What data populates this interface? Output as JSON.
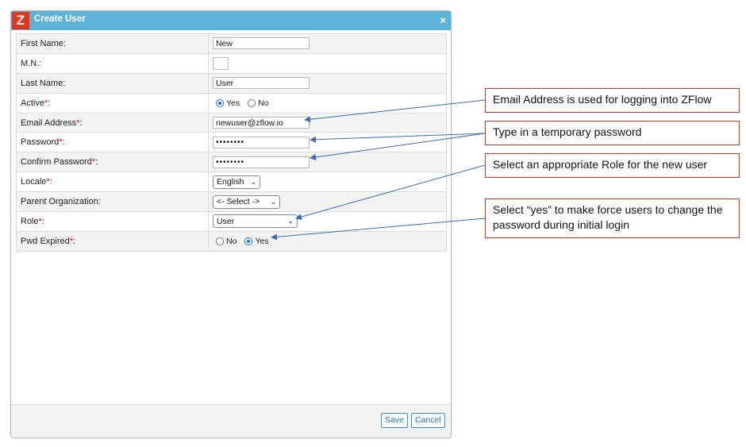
{
  "dialog": {
    "logo": "Z",
    "title": "Create User",
    "close_glyph": "×"
  },
  "fields": {
    "first_name": {
      "label": "First Name:",
      "value": "New"
    },
    "middle_name": {
      "label": "M.N.:",
      "value": ""
    },
    "last_name": {
      "label": "Last Name:",
      "value": "User"
    },
    "active": {
      "label": "Active",
      "required": "*",
      "suffix": ":",
      "options": [
        "Yes",
        "No"
      ],
      "selected": "Yes"
    },
    "email": {
      "label": "Email Address",
      "required": "*",
      "suffix": ":",
      "value": "newuser@zflow.io"
    },
    "password": {
      "label": "Password",
      "required": "*",
      "suffix": ":",
      "value": "••••••••"
    },
    "confirm_password": {
      "label": "Confirm Password",
      "required": "*",
      "suffix": ":",
      "value": "••••••••"
    },
    "locale": {
      "label": "Locale",
      "required": "*",
      "suffix": ":",
      "value": "English"
    },
    "parent_org": {
      "label": "Parent Organization:",
      "value": "<- Select ->"
    },
    "role": {
      "label": "Role",
      "required": "*",
      "suffix": ":",
      "value": "User"
    },
    "pwd_expired": {
      "label": "Pwd Expired",
      "required": "*",
      "suffix": ":",
      "options": [
        "No",
        "Yes"
      ],
      "selected": "Yes"
    }
  },
  "footer": {
    "save_label": "Save",
    "cancel_label": "Cancel"
  },
  "callouts": {
    "email": "Email Address is used for logging into ZFlow",
    "password": "Type in a temporary password",
    "role": "Select an appropriate Role for the new user",
    "pwd_expired": "Select “yes” to make force users to change the password during initial login"
  },
  "colors": {
    "titlebar": "#5fb3d9",
    "logo": "#e2371d",
    "callout_border": "#c0392b",
    "arrow": "#3b6bb5",
    "button": "#1f6fa8"
  }
}
